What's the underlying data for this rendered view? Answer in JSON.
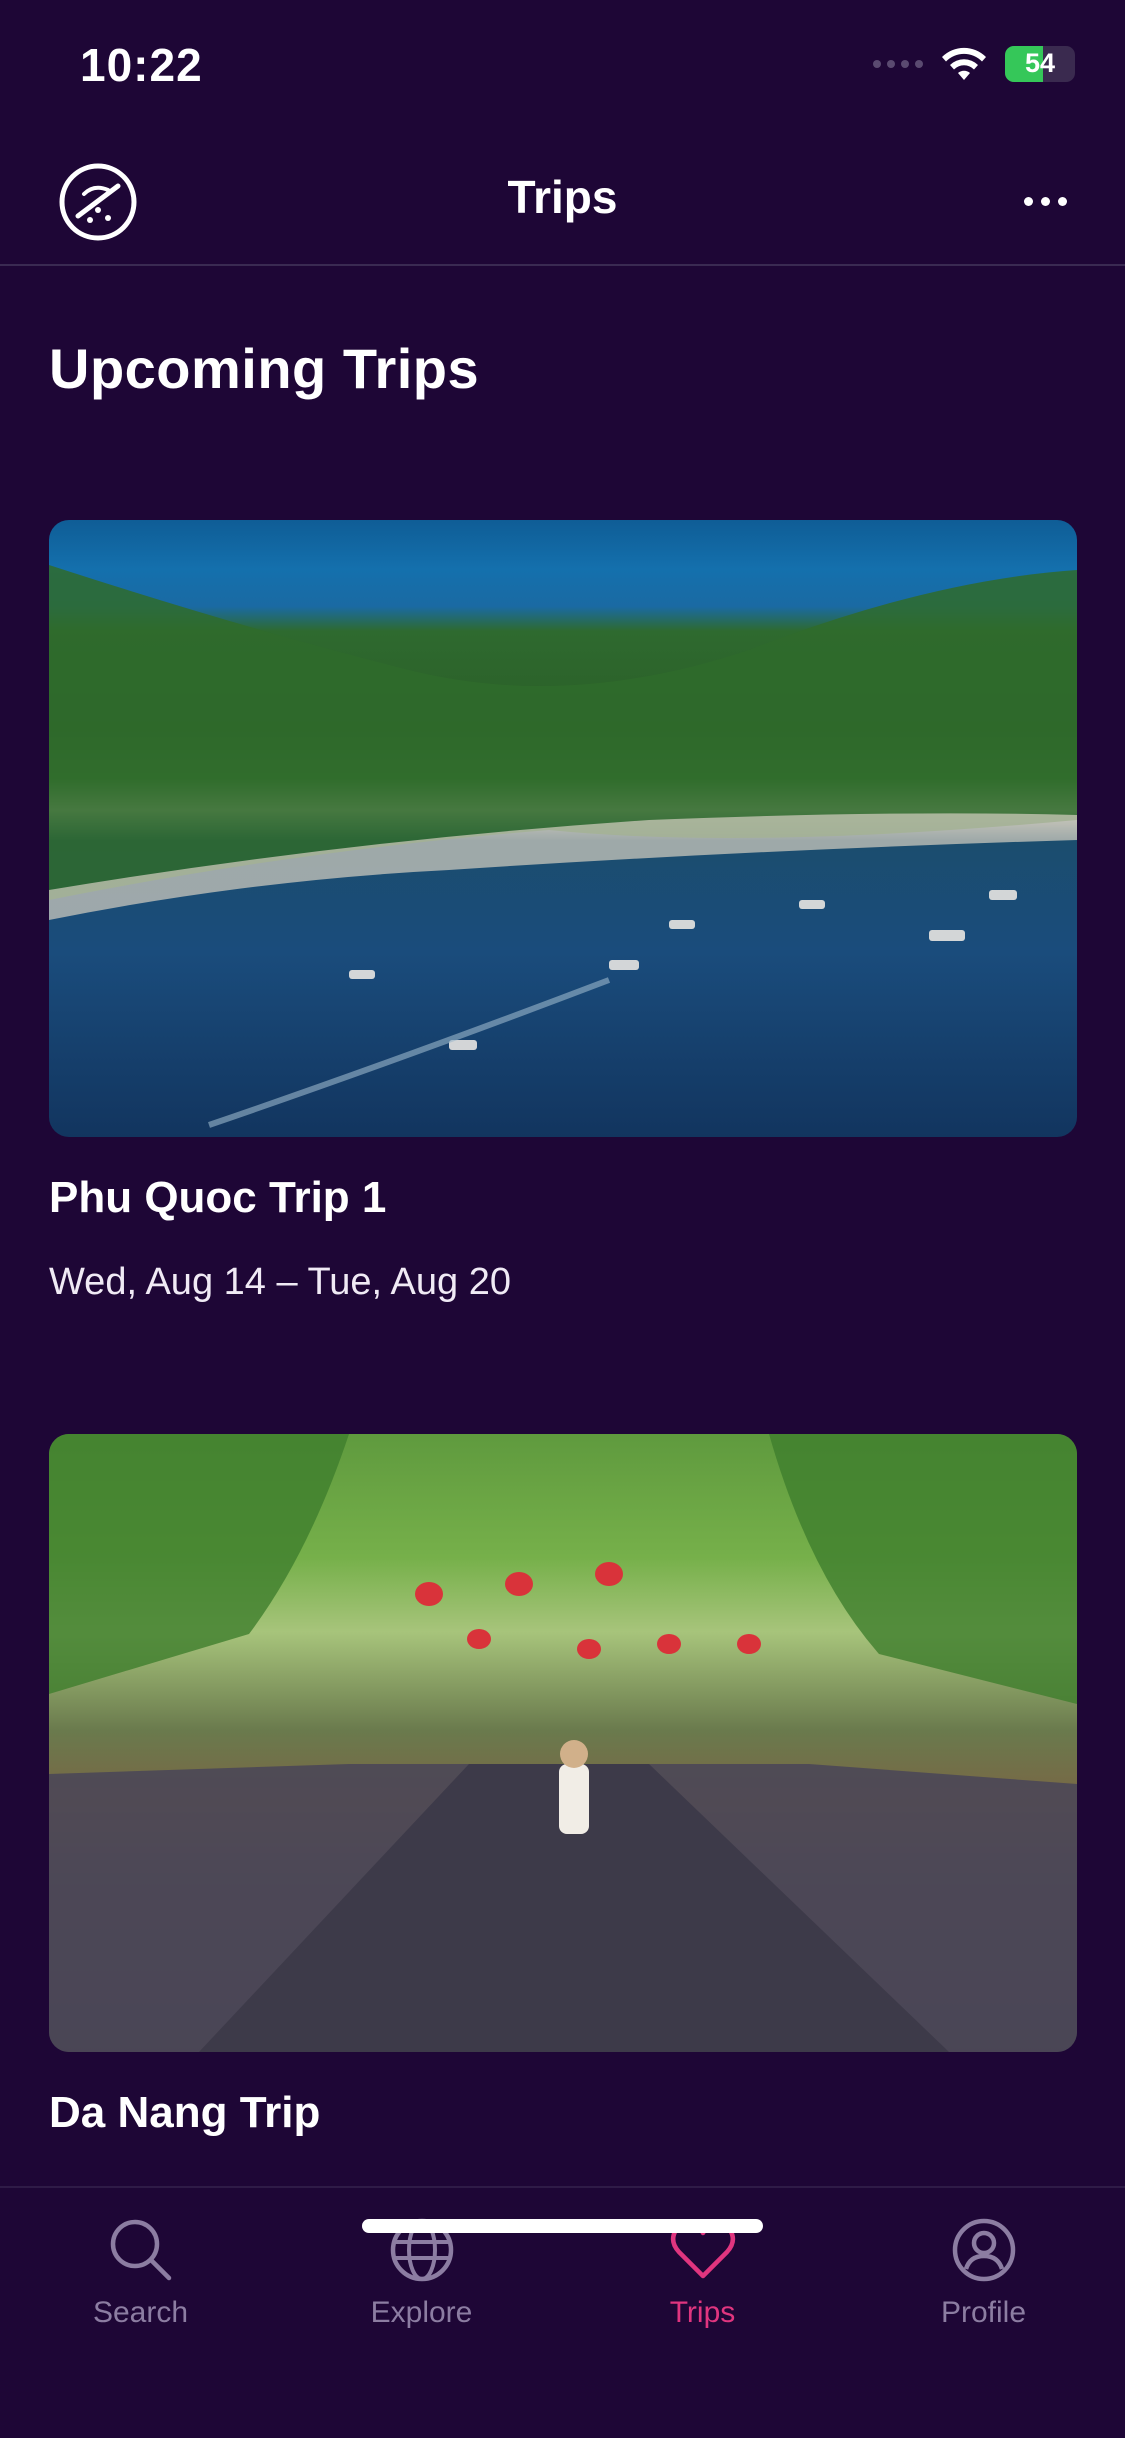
{
  "status_bar": {
    "time": "10:22",
    "battery_percent": 54,
    "battery_label": "54"
  },
  "nav": {
    "title": "Trips",
    "left_icon": "travel-compass-icon",
    "more_icon": "more-dots-icon"
  },
  "section": {
    "heading": "Upcoming Trips"
  },
  "trips": [
    {
      "title": "Phu Quoc Trip 1",
      "dates": "Wed, Aug 14 – Tue, Aug 20",
      "image": "island-bay-photo"
    },
    {
      "title": "Da Nang Trip",
      "dates": "",
      "image": "lantern-street-photo"
    }
  ],
  "tab_bar": {
    "items": [
      {
        "label": "Search",
        "icon": "search-icon",
        "active": false
      },
      {
        "label": "Explore",
        "icon": "globe-icon",
        "active": false
      },
      {
        "label": "Trips",
        "icon": "heart-icon",
        "active": true
      },
      {
        "label": "Profile",
        "icon": "profile-icon",
        "active": false
      }
    ]
  },
  "colors": {
    "background": "#1e0636",
    "accent": "#e0357f",
    "inactive": "#8c7da2",
    "battery": "#35c759"
  }
}
